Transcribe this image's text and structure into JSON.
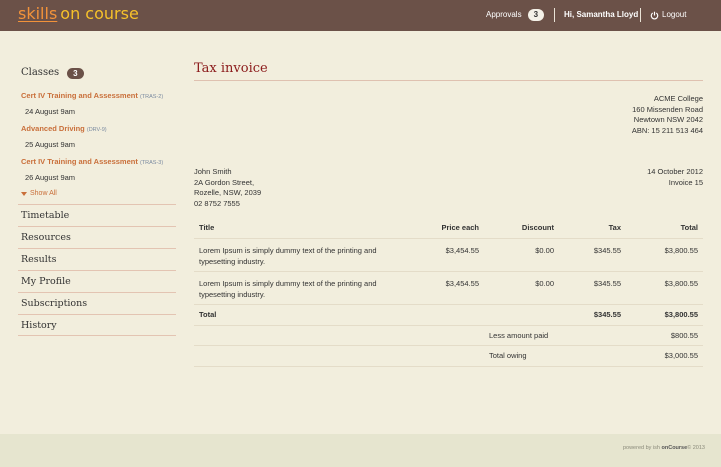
{
  "app": {
    "logo_part1": "skills",
    "logo_part2": "on course"
  },
  "topbar": {
    "approvals_label": "Approvals",
    "approvals_count": "3",
    "greeting": "Hi, Samantha Lloyd",
    "logout_label": "Logout",
    "logout_icon": "power-icon"
  },
  "sidebar": {
    "classes_label": "Classes",
    "classes_count": "3",
    "classes": [
      {
        "title": "Cert IV Training and Assessment",
        "code": "(TRAS-2)",
        "date": "24 August 9am"
      },
      {
        "title": "Advanced Driving",
        "code": "(DRV-9)",
        "date": "25 August 9am"
      },
      {
        "title": "Cert IV Training and Assessment",
        "code": "(TRAS-3)",
        "date": "26 August 9am"
      }
    ],
    "show_all": "Show All",
    "nav": [
      "Timetable",
      "Resources",
      "Results",
      "My Profile",
      "Subscriptions",
      "History"
    ]
  },
  "invoice": {
    "title": "Tax invoice",
    "college": [
      "ACME College",
      "160 Missenden Road",
      "Newtown NSW 2042",
      "ABN: 15 211 513 464"
    ],
    "bill_to": [
      "John Smith",
      "2A Gordon Street,",
      "Rozelle, NSW, 2039",
      "02 8752 7555"
    ],
    "date": "14 October 2012",
    "invoice_number": "Invoice 15",
    "columns": [
      "Title",
      "Price each",
      "Discount",
      "Tax",
      "Total"
    ],
    "rows": [
      {
        "title_line1": "Lorem Ipsum is simply dummy text of the printing and",
        "title_line2": "typesetting industry.",
        "price": "$3,454.55",
        "discount": "$0.00",
        "tax": "$345.55",
        "total": "$3,800.55"
      },
      {
        "title_line1": "Lorem Ipsum is simply dummy text of the printing and",
        "title_line2": "typesetting industry.",
        "price": "$3,454.55",
        "discount": "$0.00",
        "tax": "$345.55",
        "total": "$3,800.55"
      }
    ],
    "total_label": "Total",
    "total_tax": "$345.55",
    "total_amount": "$3,800.55",
    "less_paid_label": "Less amount paid",
    "less_paid_value": "$800.55",
    "owing_label": "Total owing",
    "owing_value": "$3,000.55"
  },
  "footer": {
    "powered_prefix": "powered by ish",
    "powered_brand": "onCourse",
    "copyright": "© 2013"
  }
}
